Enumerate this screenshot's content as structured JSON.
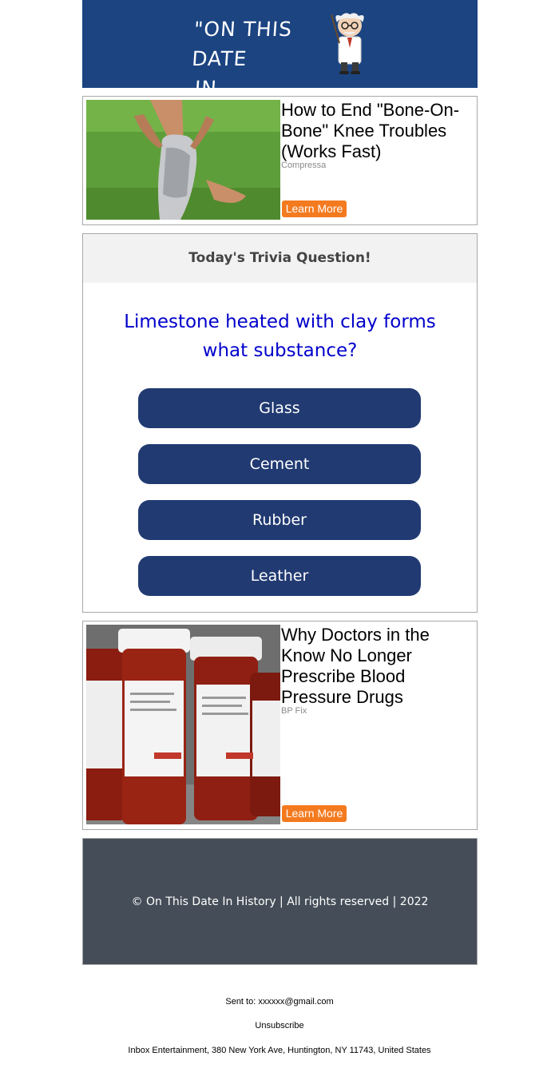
{
  "header": {
    "logo_line1": "\"ON THIS DATE",
    "logo_line2": "IN HISTORY...\"",
    "bg_color": "#1b4481"
  },
  "ads": [
    {
      "title": "How to End \"Bone-On-Bone\" Knee Troubles (Works Fast)",
      "sponsor": "Compressa",
      "button": "Learn More"
    },
    {
      "title": "Why Doctors in the Know No Longer Prescribe Blood Pressure Drugs",
      "sponsor": "BP Fix",
      "button": "Learn More"
    }
  ],
  "trivia": {
    "heading": "Today's Trivia Question!",
    "question": "Limestone heated with clay forms what substance?",
    "answers": [
      "Glass",
      "Cement",
      "Rubber",
      "Leather"
    ],
    "question_color": "#0000cc",
    "answer_color": "#213a72"
  },
  "footer": {
    "copyright": "© On This Date In History | All rights reserved | 2022",
    "bg_color": "#454e58"
  },
  "meta": {
    "sent_to": "Sent to: xxxxxx@gmail.com",
    "unsubscribe": "Unsubscribe",
    "address": "Inbox Entertainment, 380 New York Ave, Huntington, NY 11743, United States"
  },
  "accent_color": "#f47a1f"
}
